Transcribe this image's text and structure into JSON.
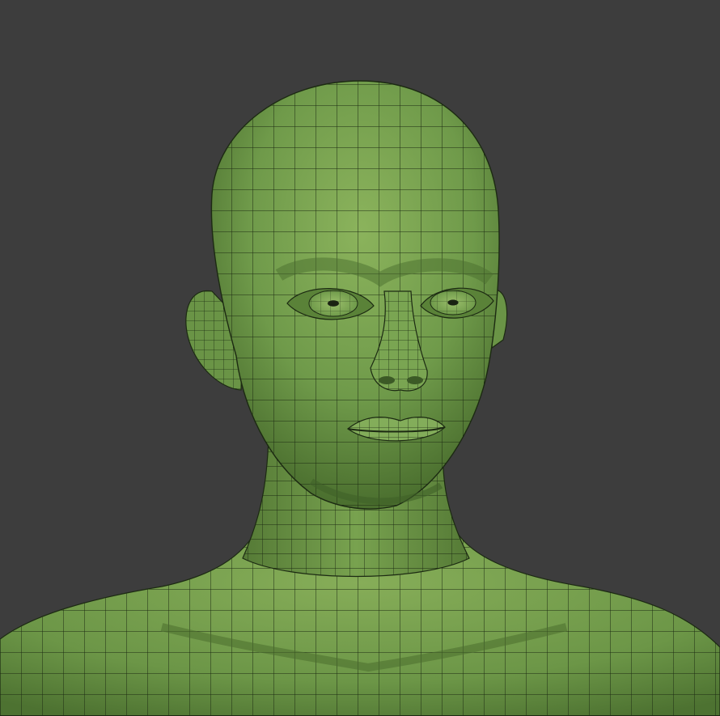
{
  "viewport": {
    "background_color": "#3d3d3d",
    "mesh_base_color": "#6f9a4a",
    "mesh_light_color": "#8bb35c",
    "mesh_shadow_color": "#4a6e2e",
    "wire_color": "#1c2a12",
    "subject": "wireframe-quad-mesh-human-head-and-shoulders"
  }
}
